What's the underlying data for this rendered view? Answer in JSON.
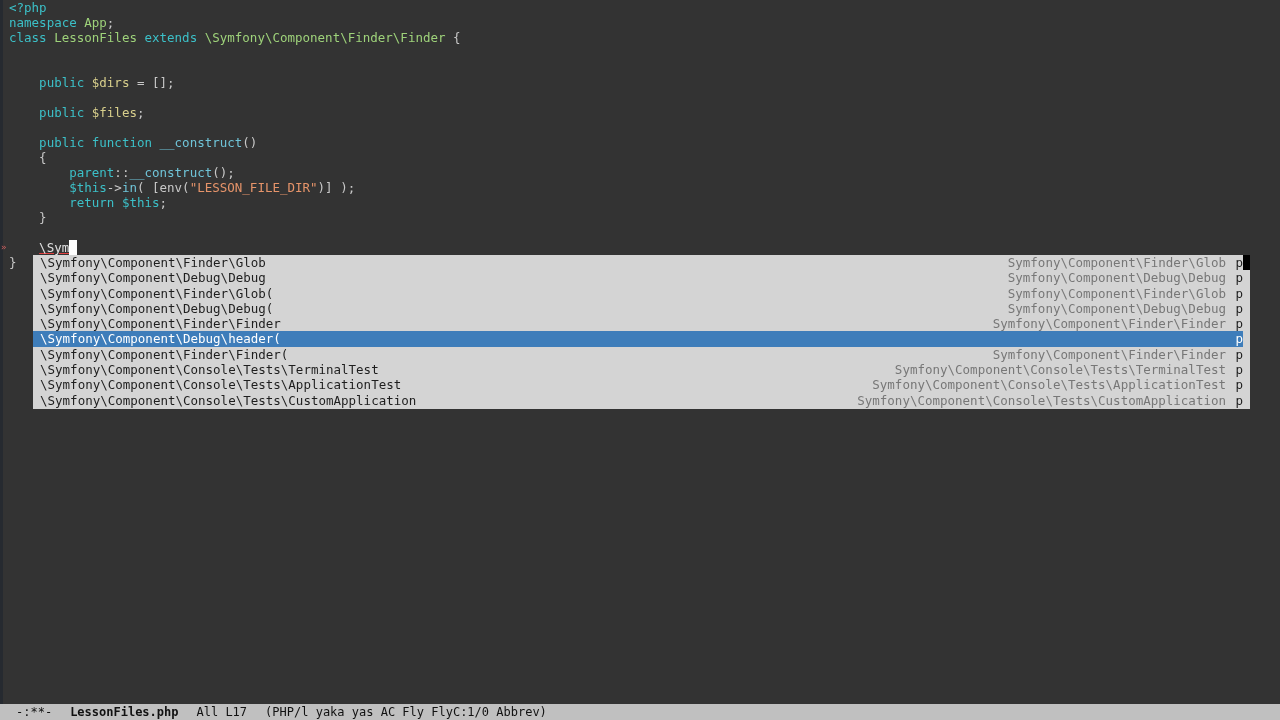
{
  "editor": {
    "lines": [
      {
        "cursor": false,
        "tokens": [
          {
            "kind": "keyword",
            "text": "<?php"
          }
        ]
      },
      {
        "cursor": false,
        "tokens": [
          {
            "kind": "keyword",
            "text": "namespace"
          },
          {
            "kind": "name",
            "text": " App"
          },
          {
            "kind": "plain",
            "text": ";"
          }
        ]
      },
      {
        "cursor": false,
        "tokens": [
          {
            "kind": "keyword",
            "text": "class"
          },
          {
            "kind": "name",
            "text": " LessonFiles"
          },
          {
            "kind": "keyword",
            "text": " extends"
          },
          {
            "kind": "name",
            "text": " \\Symfony\\Component\\Finder\\Finder"
          },
          {
            "kind": "plain",
            "text": " {"
          }
        ]
      },
      {
        "cursor": false
      },
      {
        "cursor": false
      },
      {
        "cursor": false,
        "tokens": [
          {
            "kind": "keyword",
            "text": "    public"
          },
          {
            "kind": "variable",
            "text": " $dirs"
          },
          {
            "kind": "plain",
            "text": " = [];"
          }
        ]
      },
      {
        "cursor": false
      },
      {
        "cursor": false,
        "tokens": [
          {
            "kind": "keyword",
            "text": "    public"
          },
          {
            "kind": "variable",
            "text": " $files"
          },
          {
            "kind": "plain",
            "text": ";"
          }
        ]
      },
      {
        "cursor": false
      },
      {
        "cursor": false,
        "tokens": [
          {
            "kind": "keyword",
            "text": "    public function"
          },
          {
            "kind": "function",
            "text": " __construct"
          },
          {
            "kind": "plain",
            "text": "()"
          }
        ]
      },
      {
        "cursor": false,
        "tokens": [
          {
            "kind": "plain",
            "text": "    {"
          }
        ]
      },
      {
        "cursor": false,
        "tokens": [
          {
            "kind": "keyword",
            "text": "        parent"
          },
          {
            "kind": "plain",
            "text": "::"
          },
          {
            "kind": "function",
            "text": "__construct"
          },
          {
            "kind": "plain",
            "text": "();"
          }
        ]
      },
      {
        "cursor": false,
        "tokens": [
          {
            "kind": "keyword",
            "text": "        $this"
          },
          {
            "kind": "plain",
            "text": "->"
          },
          {
            "kind": "function",
            "text": "in"
          },
          {
            "kind": "plain",
            "text": "( [env("
          },
          {
            "kind": "string",
            "text": "\"LESSON_FILE_DIR\""
          },
          {
            "kind": "plain",
            "text": ")] );"
          }
        ]
      },
      {
        "cursor": false,
        "tokens": [
          {
            "kind": "keyword",
            "text": "        return $this"
          },
          {
            "kind": "plain",
            "text": ";"
          }
        ]
      },
      {
        "cursor": false,
        "tokens": [
          {
            "kind": "plain",
            "text": "    }"
          }
        ]
      },
      {
        "cursor": false
      },
      {
        "cursor": true,
        "fringe": "»",
        "tokens": [
          {
            "kind": "error",
            "text": "    \\Sym"
          }
        ]
      },
      {
        "cursor": false,
        "tokens": [
          {
            "kind": "plain",
            "text": "}"
          }
        ]
      }
    ]
  },
  "completion": {
    "items": [
      {
        "candidate": "\\Symfony\\Component\\Finder\\Glob",
        "annotation": "Symfony\\Component\\Finder\\Glob",
        "type": "p",
        "selected": false
      },
      {
        "candidate": "\\Symfony\\Component\\Debug\\Debug",
        "annotation": "Symfony\\Component\\Debug\\Debug",
        "type": "p",
        "selected": false
      },
      {
        "candidate": "\\Symfony\\Component\\Finder\\Glob(",
        "annotation": "Symfony\\Component\\Finder\\Glob",
        "type": "p",
        "selected": false
      },
      {
        "candidate": "\\Symfony\\Component\\Debug\\Debug(",
        "annotation": "Symfony\\Component\\Debug\\Debug",
        "type": "p",
        "selected": false
      },
      {
        "candidate": "\\Symfony\\Component\\Finder\\Finder",
        "annotation": "Symfony\\Component\\Finder\\Finder",
        "type": "p",
        "selected": false
      },
      {
        "candidate": "\\Symfony\\Component\\Debug\\header(",
        "type": "p",
        "selected": true
      },
      {
        "candidate": "\\Symfony\\Component\\Finder\\Finder(",
        "annotation": "Symfony\\Component\\Finder\\Finder",
        "type": "p",
        "selected": false
      },
      {
        "candidate": "\\Symfony\\Component\\Console\\Tests\\TerminalTest",
        "annotation": "Symfony\\Component\\Console\\Tests\\TerminalTest",
        "type": "p",
        "selected": false
      },
      {
        "candidate": "\\Symfony\\Component\\Console\\Tests\\ApplicationTest",
        "annotation": "Symfony\\Component\\Console\\Tests\\ApplicationTest",
        "type": "p",
        "selected": false
      },
      {
        "candidate": "\\Symfony\\Component\\Console\\Tests\\CustomApplication",
        "annotation": "Symfony\\Component\\Console\\Tests\\CustomApplication",
        "type": "p",
        "selected": false
      }
    ]
  },
  "mode_line": {
    "status": "-:**-",
    "buffer": "LessonFiles.php",
    "position": "All L17",
    "modes": "(PHP/l yaka yas AC Fly FlyC:1/0 Abbrev)"
  }
}
